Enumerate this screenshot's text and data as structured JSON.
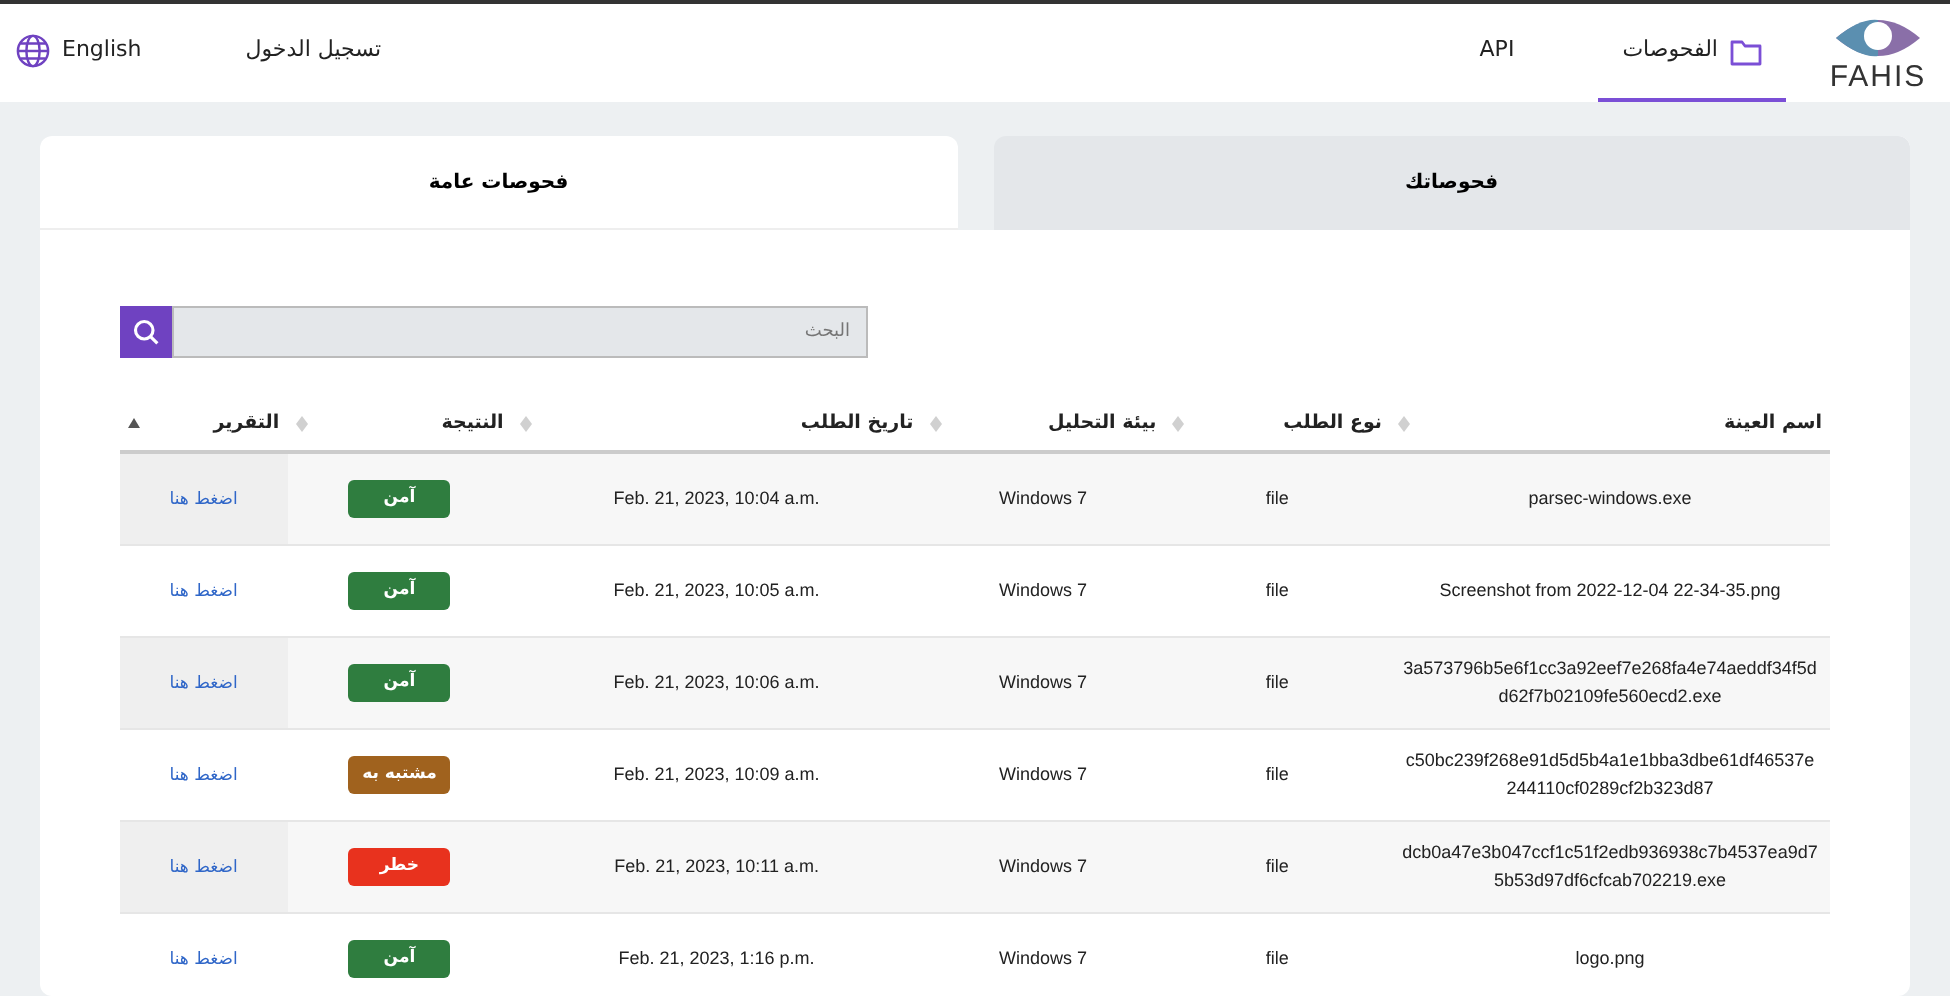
{
  "brand": {
    "name": "FAHIS"
  },
  "nav": [
    {
      "label": "الفحوصات",
      "selected": true
    },
    {
      "label": "API",
      "selected": false
    }
  ],
  "auth": {
    "login": "تسجيل الدخول",
    "language": "English"
  },
  "tabs": [
    {
      "label": "فحوصاتك",
      "selected": false
    },
    {
      "label": "فحوصات عامة",
      "selected": true
    }
  ],
  "search": {
    "placeholder": "البحث"
  },
  "table": {
    "columns": [
      {
        "label": "اسم العينة",
        "sorted": false
      },
      {
        "label": "نوع الطلب",
        "sorted": false
      },
      {
        "label": "بيئة التحليل",
        "sorted": false
      },
      {
        "label": "تاريخ الطلب",
        "sorted": false
      },
      {
        "label": "النتيجة",
        "sorted": false
      },
      {
        "label": "التقرير",
        "sorted": true
      }
    ],
    "rows": [
      {
        "sample": "parsec-windows.exe",
        "type": "file",
        "env": "Windows 7",
        "date": "Feb. 21, 2023, 10:04 a.m.",
        "result": {
          "label": "آمن",
          "color": "#2f7d3f"
        },
        "report": "اضغط هنا"
      },
      {
        "sample": "Screenshot from 2022-12-04 22-34-35.png",
        "type": "file",
        "env": "Windows 7",
        "date": "Feb. 21, 2023, 10:05 a.m.",
        "result": {
          "label": "آمن",
          "color": "#2f7d3f"
        },
        "report": "اضغط هنا"
      },
      {
        "sample": "3a573796b5e6f1cc3a92eef7e268fa4e74aeddf34f5dd62f7b02109fe560ecd2.exe",
        "type": "file",
        "env": "Windows 7",
        "date": "Feb. 21, 2023, 10:06 a.m.",
        "result": {
          "label": "آمن",
          "color": "#2f7d3f"
        },
        "report": "اضغط هنا"
      },
      {
        "sample": "c50bc239f268e91d5d5b4a1e1bba3dbe61df46537e244110cf0289cf2b323d87",
        "type": "file",
        "env": "Windows 7",
        "date": "Feb. 21, 2023, 10:09 a.m.",
        "result": {
          "label": "مشتبه به",
          "color": "#a0621e"
        },
        "report": "اضغط هنا"
      },
      {
        "sample": "dcb0a47e3b047ccf1c51f2edb936938c7b4537ea9d75b53d97df6cfcab702219.exe",
        "type": "file",
        "env": "Windows 7",
        "date": "Feb. 21, 2023, 10:11 a.m.",
        "result": {
          "label": "خطر",
          "color": "#e8321e"
        },
        "report": "اضغط هنا"
      },
      {
        "sample": "logo.png",
        "type": "file",
        "env": "Windows 7",
        "date": "Feb. 21, 2023, 1:16 p.m.",
        "result": {
          "label": "آمن",
          "color": "#2f7d3f"
        },
        "report": "اضغط هنا"
      }
    ]
  }
}
